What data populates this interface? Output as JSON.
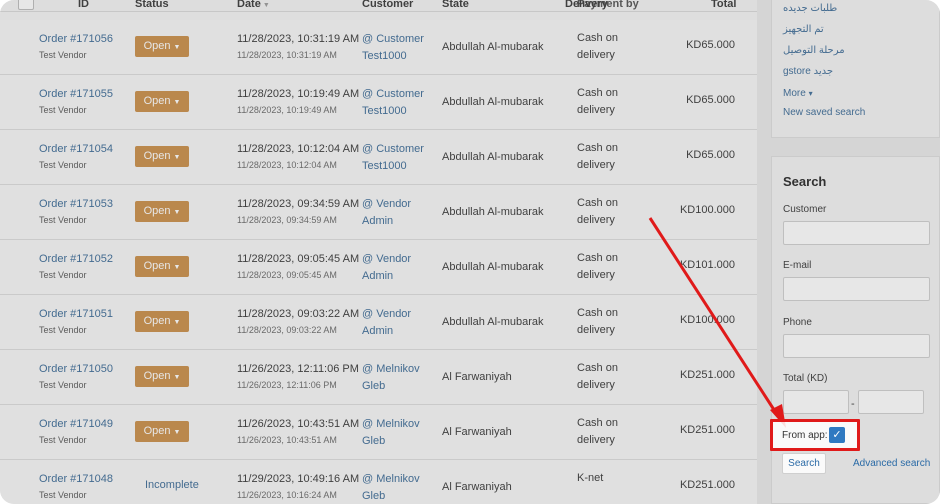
{
  "table": {
    "headers": {
      "id": "ID",
      "status": "Status",
      "date": "Date",
      "customer": "Customer",
      "state": "State",
      "delivery_overlap_a": "Delivery",
      "delivery_overlap_b": "Payment by",
      "total": "Total"
    },
    "rows": [
      {
        "order": "Order #171056",
        "vendor": "Test Vendor",
        "status": "Open",
        "date": "11/28/2023, 10:31:19 AM",
        "date_sub": "11/28/2023, 10:31:19 AM",
        "cust1": "@ Customer",
        "cust2": "Test1000",
        "state": "Abdullah Al-mubarak",
        "pay1": "Cash on",
        "pay2": "delivery",
        "total": "KD65.000"
      },
      {
        "order": "Order #171055",
        "vendor": "Test Vendor",
        "status": "Open",
        "date": "11/28/2023, 10:19:49 AM",
        "date_sub": "11/28/2023, 10:19:49 AM",
        "cust1": "@ Customer",
        "cust2": "Test1000",
        "state": "Abdullah Al-mubarak",
        "pay1": "Cash on",
        "pay2": "delivery",
        "total": "KD65.000"
      },
      {
        "order": "Order #171054",
        "vendor": "Test Vendor",
        "status": "Open",
        "date": "11/28/2023, 10:12:04 AM",
        "date_sub": "11/28/2023, 10:12:04 AM",
        "cust1": "@ Customer",
        "cust2": "Test1000",
        "state": "Abdullah Al-mubarak",
        "pay1": "Cash on",
        "pay2": "delivery",
        "total": "KD65.000"
      },
      {
        "order": "Order #171053",
        "vendor": "Test Vendor",
        "status": "Open",
        "date": "11/28/2023, 09:34:59 AM",
        "date_sub": "11/28/2023, 09:34:59 AM",
        "cust1": "@ Vendor",
        "cust2": "Admin",
        "state": "Abdullah Al-mubarak",
        "pay1": "Cash on",
        "pay2": "delivery",
        "total": "KD100.000"
      },
      {
        "order": "Order #171052",
        "vendor": "Test Vendor",
        "status": "Open",
        "date": "11/28/2023, 09:05:45 AM",
        "date_sub": "11/28/2023, 09:05:45 AM",
        "cust1": "@ Vendor",
        "cust2": "Admin",
        "state": "Abdullah Al-mubarak",
        "pay1": "Cash on",
        "pay2": "delivery",
        "total": "KD101.000"
      },
      {
        "order": "Order #171051",
        "vendor": "Test Vendor",
        "status": "Open",
        "date": "11/28/2023, 09:03:22 AM",
        "date_sub": "11/28/2023, 09:03:22 AM",
        "cust1": "@ Vendor",
        "cust2": "Admin",
        "state": "Abdullah Al-mubarak",
        "pay1": "Cash on",
        "pay2": "delivery",
        "total": "KD100.000"
      },
      {
        "order": "Order #171050",
        "vendor": "Test Vendor",
        "status": "Open",
        "date": "11/26/2023, 12:11:06 PM",
        "date_sub": "11/26/2023, 12:11:06 PM",
        "cust1": "@ Melnikov",
        "cust2": "Gleb",
        "state": "Al Farwaniyah",
        "pay1": "Cash on",
        "pay2": "delivery",
        "total": "KD251.000"
      },
      {
        "order": "Order #171049",
        "vendor": "Test Vendor",
        "status": "Open",
        "date": "11/26/2023, 10:43:51 AM",
        "date_sub": "11/26/2023, 10:43:51 AM",
        "cust1": "@ Melnikov",
        "cust2": "Gleb",
        "state": "Al Farwaniyah",
        "pay1": "Cash on",
        "pay2": "delivery",
        "total": "KD251.000"
      },
      {
        "order": "Order #171048",
        "vendor": "Test Vendor",
        "status": "Incomplete",
        "date": "11/29/2023, 10:49:16 AM",
        "date_sub": "11/26/2023, 10:16:24 AM",
        "cust1": "@ Melnikov",
        "cust2": "Gleb",
        "state": "Al Farwaniyah",
        "pay1": "K-net",
        "pay2": "",
        "total": "KD251.000"
      }
    ]
  },
  "sidebar": {
    "saved": {
      "items": [
        "طلبات جديده",
        "تم التجهيز",
        "مرحلة التوصيل",
        "gstore جديد"
      ],
      "more": "More",
      "new_saved": "New saved search"
    },
    "search": {
      "title": "Search",
      "customer_label": "Customer",
      "email_label": "E-mail",
      "phone_label": "Phone",
      "total_label": "Total (KD)",
      "range_dash": "-",
      "from_app_label": "From app:",
      "search_button": "Search",
      "advanced_link": "Advanced search"
    }
  },
  "colors": {
    "status_open": "#d9892a",
    "link": "#2a6aa6",
    "annotation": "#e01a1a",
    "checkbox": "#2f79c1"
  },
  "icons": [
    "caret-down-icon",
    "sort-icon",
    "checkmark-icon",
    "arrow-annotation"
  ]
}
